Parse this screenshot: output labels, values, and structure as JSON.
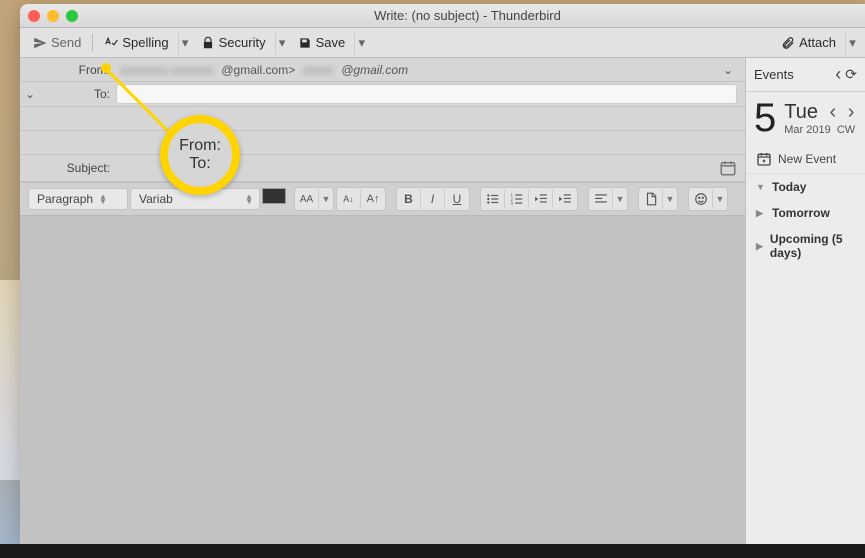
{
  "window": {
    "title": "Write: (no subject) - Thunderbird"
  },
  "toolbar": {
    "send": "Send",
    "spelling": "Spelling",
    "security": "Security",
    "save": "Save",
    "attach": "Attach"
  },
  "headers": {
    "from_label": "From:",
    "from_obscured1": "xxxxxxxx xxxxxxx",
    "from_addr1": "@gmail.com>",
    "from_obscured2": "xxxxx",
    "from_addr2": "@gmail.com",
    "to_label": "To:",
    "subject_label": "Subject:"
  },
  "format": {
    "para_style": "Paragraph",
    "font_family_partial": "Variab"
  },
  "sidebar": {
    "title": "Events",
    "day_num": "5",
    "day_name": "Tue",
    "month_year": "Mar 2019",
    "cw": "CW",
    "new_event": "New Event",
    "sections": {
      "today": "Today",
      "tomorrow": "Tomorrow",
      "upcoming": "Upcoming (5 days)"
    }
  },
  "magnifier": {
    "line1": "From:",
    "line2": "To:"
  }
}
